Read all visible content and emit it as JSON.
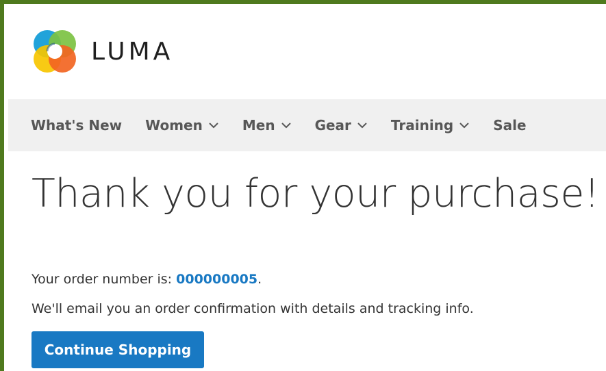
{
  "header": {
    "logo_text": "LUMA",
    "logo_icon": "luma-logo-icon"
  },
  "nav": {
    "items": [
      {
        "label": "What's New",
        "has_dropdown": false
      },
      {
        "label": "Women",
        "has_dropdown": true
      },
      {
        "label": "Men",
        "has_dropdown": true
      },
      {
        "label": "Gear",
        "has_dropdown": true
      },
      {
        "label": "Training",
        "has_dropdown": true
      },
      {
        "label": "Sale",
        "has_dropdown": false
      }
    ]
  },
  "main": {
    "title": "Thank you for your purchase!",
    "order_prefix": "Your order number is: ",
    "order_number": "000000005",
    "order_suffix": ".",
    "email_text": "We'll email you an order confirmation with details and tracking info.",
    "continue_label": "Continue Shopping"
  },
  "colors": {
    "frame_border": "#4f7a1e",
    "nav_bg": "#f0f0f0",
    "link_blue": "#1979c3",
    "button_bg": "#1979c3",
    "text": "#333333"
  }
}
